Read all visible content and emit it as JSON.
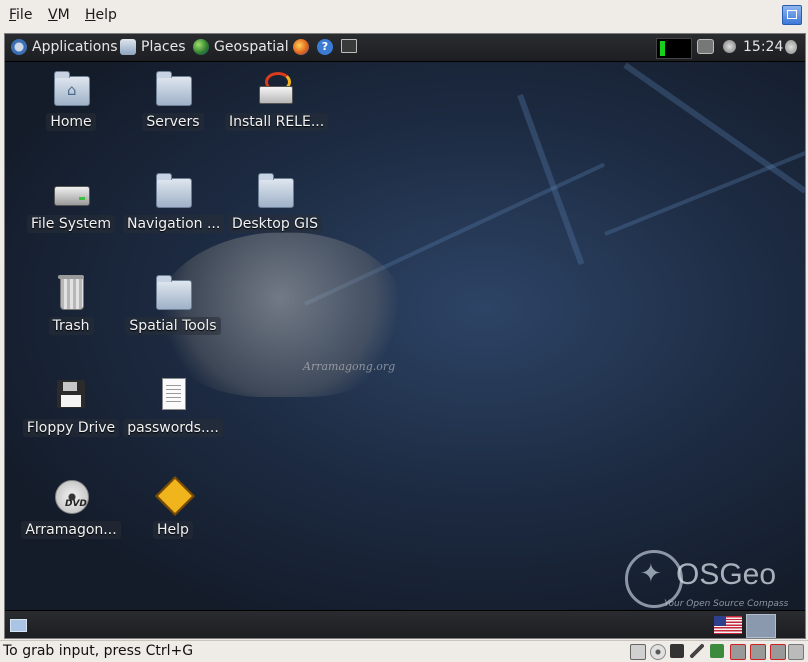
{
  "host_menu": {
    "file": "File",
    "file_key": "F",
    "file_rest": "ile",
    "vm_key": "V",
    "vm_rest": "M",
    "help_key": "H",
    "help_rest": "elp"
  },
  "top_panel": {
    "applications": "Applications",
    "places": "Places",
    "geospatial": "Geospatial",
    "clock": "15:24"
  },
  "desktop_icons": [
    {
      "label": "Home",
      "icon": "home-folder-icon"
    },
    {
      "label": "Servers",
      "icon": "folder-icon"
    },
    {
      "label": "Install RELE...",
      "icon": "installer-icon"
    },
    {
      "label": "File System",
      "icon": "hard-drive-icon"
    },
    {
      "label": "Navigation ...",
      "icon": "folder-icon"
    },
    {
      "label": "Desktop GIS",
      "icon": "folder-icon"
    },
    {
      "label": "Trash",
      "icon": "trash-icon"
    },
    {
      "label": "Spatial Tools",
      "icon": "folder-icon"
    },
    {
      "label": "Floppy Drive",
      "icon": "floppy-icon"
    },
    {
      "label": "passwords....",
      "icon": "text-file-icon"
    },
    {
      "label": "Arramagon...",
      "icon": "dvd-icon"
    },
    {
      "label": "Help",
      "icon": "help-icon"
    }
  ],
  "wallpaper": {
    "watermark_text": "Arramagong.org",
    "brand": "OSGeo",
    "tagline": "Your Open Source Compass"
  },
  "dvd_label": "DVD",
  "statusbar": {
    "text": "To grab input, press Ctrl+G"
  }
}
